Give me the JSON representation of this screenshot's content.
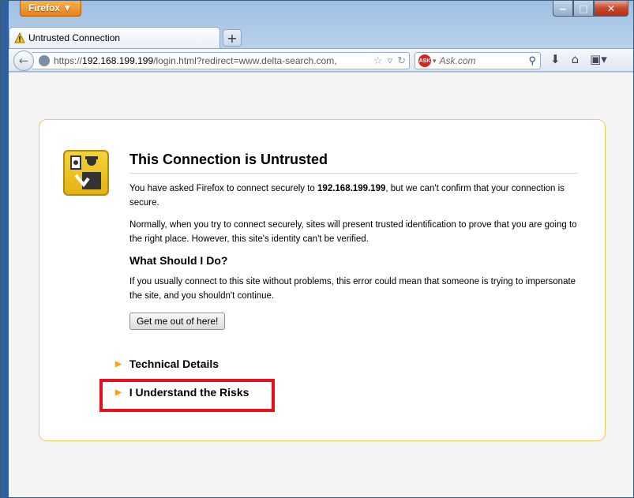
{
  "window": {
    "menu_label": "Firefox ▼",
    "minimize": "‒",
    "maximize": "□",
    "close": "✕"
  },
  "tab": {
    "title": "Untrusted Connection",
    "icon": "warning-icon",
    "new_tab_label": "+"
  },
  "toolbar": {
    "url_scheme": "https://",
    "url_host": "192.168.199.199",
    "url_rest": "/login.html?redirect=www.delta-search.com,",
    "search_placeholder": "Ask.com",
    "search_engine_logo": "ASK",
    "icons": [
      "bookmark-star-icon",
      "dropdown-icon",
      "reload-icon",
      "search-icon",
      "downloads-icon",
      "home-icon",
      "bookmarks-menu-icon"
    ]
  },
  "page": {
    "title": "This Connection is Untrusted",
    "para1_before": "You have asked Firefox to connect securely to ",
    "para1_host": "192.168.199.199",
    "para1_after": ", but we can't confirm that your connection is secure.",
    "para2": "Normally, when you try to connect securely, sites will present trusted identification to prove that you are going to the right place. However, this site's identity can't be verified.",
    "heading2": "What Should I Do?",
    "para3": "If you usually connect to this site without problems, this error could mean that someone is trying to impersonate the site, and you shouldn't continue.",
    "button": "Get me out of here!",
    "technical_details": "Technical Details",
    "understand_risks": "I Understand the Risks"
  },
  "colors": {
    "highlight": "#e8101c",
    "card_border": "#f2c75e",
    "expander_triangle": "#f3a418"
  }
}
